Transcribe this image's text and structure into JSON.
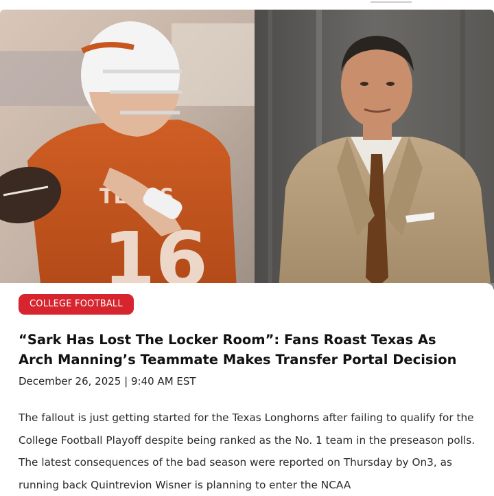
{
  "article": {
    "category": "COLLEGE FOOTBALL",
    "headline": "“Sark Has Lost The Locker Room”: Fans Roast Texas As Arch Manning’s Teammate Makes Transfer Portal Decision",
    "date": "December 26, 2025",
    "separator": "|",
    "time": "9:40 AM EST",
    "body": "The fallout is just getting started for the Texas Longhorns after failing to qualify for the College Football Playoff despite being ranked as the No. 1 team in the preseason polls. The latest consequences of the bad season were reported on Thursday by On3, as running back Quintrevion Wisner is planning to enter the NCAA"
  },
  "hero": {
    "jersey_text": "TEXAS",
    "jersey_number": "16",
    "colors": {
      "burnt_orange": "#c8561f",
      "category_red": "#d6252e",
      "suit_tan": "#b49a78"
    }
  }
}
